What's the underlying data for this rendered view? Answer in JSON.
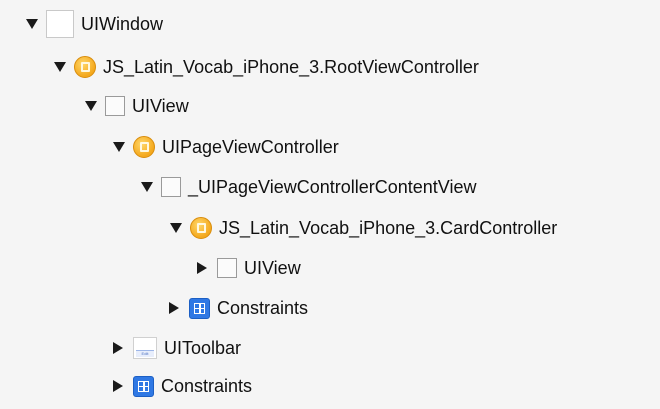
{
  "tree": {
    "items": [
      {
        "label": "UIWindow",
        "icon": "view-icon",
        "expanded": true
      },
      {
        "label": "JS_Latin_Vocab_iPhone_3.RootViewController",
        "icon": "view-controller-icon",
        "expanded": true
      },
      {
        "label": "UIView",
        "icon": "view-icon",
        "expanded": true
      },
      {
        "label": "UIPageViewController",
        "icon": "view-controller-icon",
        "expanded": true
      },
      {
        "label": "_UIPageViewControllerContentView",
        "icon": "view-icon",
        "expanded": true
      },
      {
        "label": "JS_Latin_Vocab_iPhone_3.CardController",
        "icon": "view-controller-icon",
        "expanded": true
      },
      {
        "label": "UIView",
        "icon": "view-icon",
        "expanded": false
      },
      {
        "label": "Constraints",
        "icon": "constraints-icon",
        "expanded": false
      },
      {
        "label": "UIToolbar",
        "icon": "toolbar-icon",
        "expanded": false
      },
      {
        "label": "Constraints",
        "icon": "constraints-icon",
        "expanded": false
      }
    ]
  },
  "colors": {
    "background": "#f5f5f5",
    "view_controller": "#f4a81c",
    "constraints": "#2f78e4"
  }
}
